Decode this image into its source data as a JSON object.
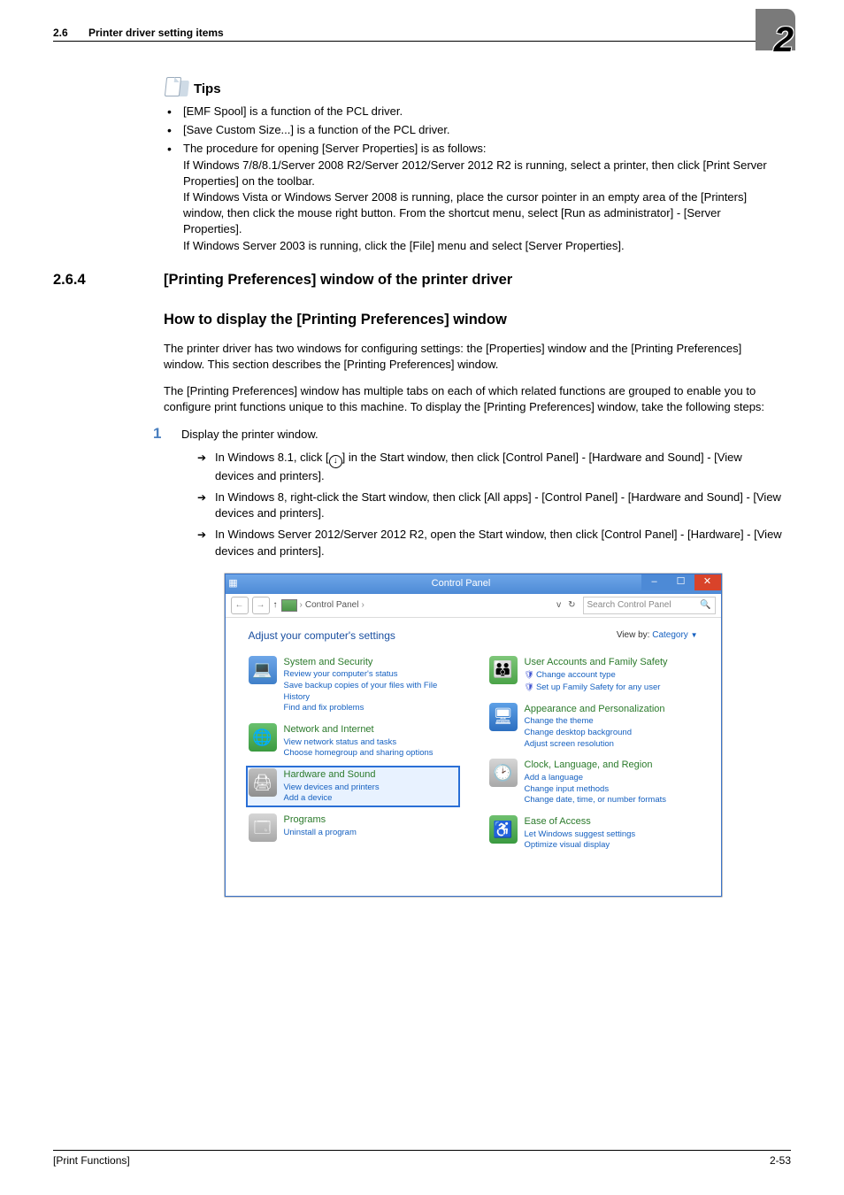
{
  "header": {
    "section_no": "2.6",
    "section_title": "Printer driver setting items",
    "chapter_no": "2"
  },
  "tips": {
    "heading": "Tips",
    "items": [
      "[EMF Spool] is a function of the PCL driver.",
      "[Save Custom Size...] is a function of the PCL driver.",
      "The procedure for opening [Server Properties] is as follows:\nIf Windows 7/8/8.1/Server 2008 R2/Server 2012/Server 2012 R2 is running, select a printer, then click [Print Server Properties] on the toolbar.\nIf Windows Vista or Windows Server 2008 is running, place the cursor pointer in an empty area of the [Printers] window, then click the mouse right button. From the shortcut menu, select [Run as administrator] - [Server Properties].\nIf Windows Server 2003 is running, click the [File] menu and select [Server Properties]."
    ]
  },
  "h2": {
    "num": "2.6.4",
    "text": "[Printing Preferences] window of the printer driver"
  },
  "h3": "How to display the [Printing Preferences] window",
  "para1": "The printer driver has two windows for configuring settings: the [Properties] window and the [Printing Preferences] window. This section describes the [Printing Preferences] window.",
  "para2": "The [Printing Preferences] window has multiple tabs on each of which related functions are grouped to enable you to configure print functions unique to this machine. To display the [Printing Preferences] window, take the following steps:",
  "step": {
    "num": "1",
    "text": "Display the printer window.",
    "arrows": [
      {
        "pre": "In Windows 8.1, click [",
        "mid_icon": "↓",
        "post": "] in the Start window, then click [Control Panel] - [Hardware and Sound] - [View devices and printers]."
      },
      {
        "text": "In Windows 8, right-click the Start window, then click [All apps] - [Control Panel] - [Hardware and Sound] - [View devices and printers]."
      },
      {
        "text": "In Windows Server 2012/Server 2012 R2, open the Start window, then click [Control Panel] - [Hardware] - [View devices and printers]."
      }
    ]
  },
  "screenshot": {
    "window_title": "Control Panel",
    "breadcrumb_label": "Control Panel",
    "breadcrumb_sep": "›",
    "refresh_sep": "v",
    "refresh_icon": "↻",
    "search_placeholder": "Search Control Panel",
    "search_icon": "🔍",
    "adjust_heading": "Adjust your computer's settings",
    "viewby_label": "View by:",
    "viewby_value": "Category",
    "columns": {
      "left": [
        {
          "title": "System and Security",
          "icon_bg": "linear-gradient(#6ea6e8,#3f7fc9)",
          "icon_glyph": "💻",
          "subs": [
            "Review your computer's status",
            "Save backup copies of your files with File History",
            "Find and fix problems"
          ]
        },
        {
          "title": "Network and Internet",
          "icon_bg": "linear-gradient(#69c06e,#3a9a40)",
          "icon_glyph": "🌐",
          "subs": [
            "View network status and tasks",
            "Choose homegroup and sharing options"
          ],
          "truncate_last": true
        },
        {
          "title": "Hardware and Sound",
          "icon_bg": "linear-gradient(#bfbfbf,#8f8f8f)",
          "icon_glyph": "🖨",
          "subs": [
            "View devices and printers",
            "Add a device"
          ],
          "highlight": true
        },
        {
          "title": "Programs",
          "icon_bg": "linear-gradient(#d6d6d6,#a8a8a8)",
          "icon_glyph": "🗔",
          "subs": [
            "Uninstall a program"
          ]
        }
      ],
      "right": [
        {
          "title": "User Accounts and Family Safety",
          "icon_bg": "linear-gradient(#7fc77a,#4ba348)",
          "icon_glyph": "👪",
          "subs": [
            {
              "t": "Change account type",
              "shield": true
            },
            {
              "t": "Set up Family Safety for any user",
              "shield": true
            }
          ]
        },
        {
          "title": "Appearance and Personalization",
          "icon_bg": "linear-gradient(#5da0e6,#2d6fc0)",
          "icon_glyph": "🖥",
          "subs": [
            "Change the theme",
            "Change desktop background",
            "Adjust screen resolution"
          ]
        },
        {
          "title": "Clock, Language, and Region",
          "icon_bg": "linear-gradient(#d6d6d6,#a8a8a8)",
          "icon_glyph": "🕑",
          "subs": [
            "Add a language",
            "Change input methods",
            "Change date, time, or number formats"
          ]
        },
        {
          "title": "Ease of Access",
          "icon_bg": "linear-gradient(#6fc06f,#3a9a40)",
          "icon_glyph": "♿",
          "subs": [
            "Let Windows suggest settings",
            "Optimize visual display"
          ]
        }
      ]
    }
  },
  "footer": {
    "left": "[Print Functions]",
    "right": "2-53"
  }
}
